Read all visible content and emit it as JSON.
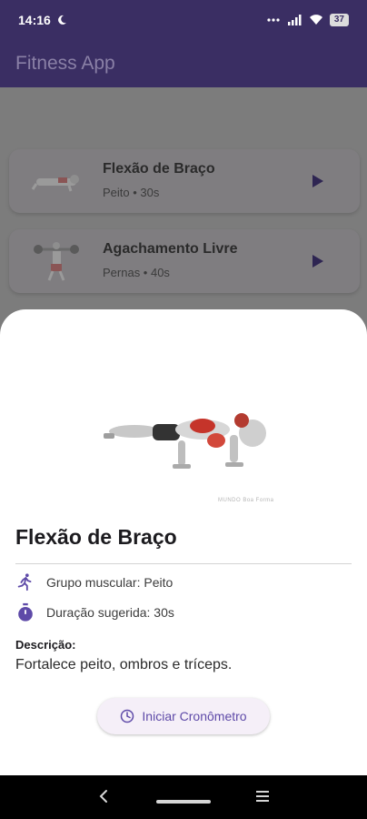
{
  "status": {
    "time": "14:16",
    "battery": "37"
  },
  "app": {
    "title": "Fitness App"
  },
  "list": [
    {
      "title": "Flexão de Braço",
      "subtitle": "Peito • 30s"
    },
    {
      "title": "Agachamento Livre",
      "subtitle": "Pernas • 40s"
    }
  ],
  "detail": {
    "title": "Flexão de Braço",
    "watermark": "MUNDO Boa Forma",
    "muscle_group": "Grupo muscular: Peito",
    "duration": "Duração sugerida: 30s",
    "description_label": "Descrição:",
    "description": "Fortalece peito, ombros e tríceps.",
    "timer_button": "Iniciar Cronômetro"
  },
  "colors": {
    "accent": "#5e4aa8",
    "appbar": "#3a2e63"
  }
}
